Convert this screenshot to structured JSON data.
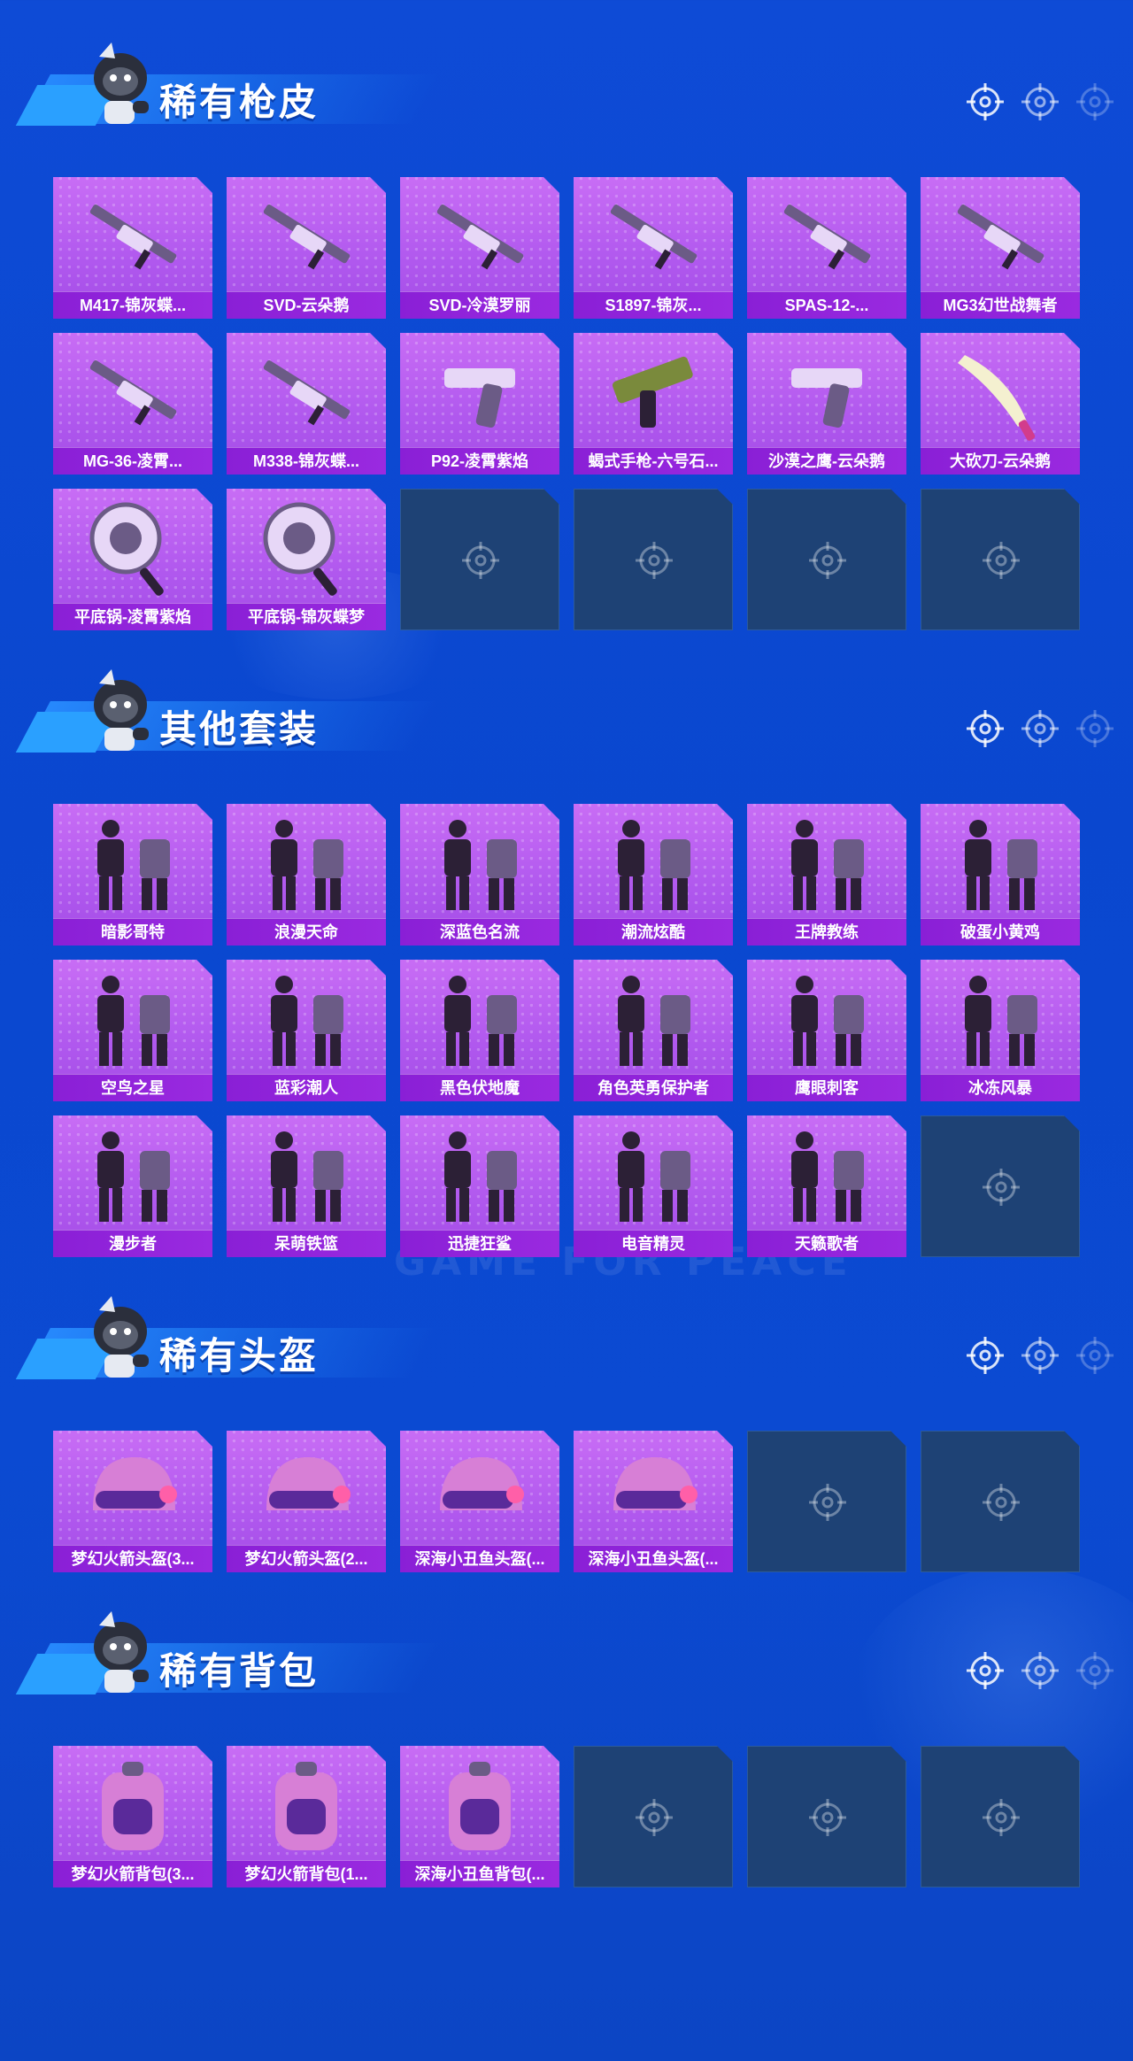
{
  "sections": [
    {
      "title": "稀有枪皮",
      "rows": [
        [
          {
            "label": "M417-锦灰蝶...",
            "icon": "rifle-icon"
          },
          {
            "label": "SVD-云朵鹅",
            "icon": "sniper-rifle-icon"
          },
          {
            "label": "SVD-冷漠罗丽",
            "icon": "sniper-rifle-icon"
          },
          {
            "label": "S1897-锦灰...",
            "icon": "shotgun-icon"
          },
          {
            "label": "SPAS-12-...",
            "icon": "shotgun-icon"
          },
          {
            "label": "MG3幻世战舞者",
            "icon": "machine-gun-icon"
          }
        ],
        [
          {
            "label": "MG-36-凌霄...",
            "icon": "rifle-icon"
          },
          {
            "label": "M338-锦灰蝶...",
            "icon": "rifle-icon"
          },
          {
            "label": "P92-凌霄紫焰",
            "icon": "pistol-icon"
          },
          {
            "label": "蝎式手枪-六号石...",
            "icon": "smg-icon"
          },
          {
            "label": "沙漠之鹰-云朵鹅",
            "icon": "pistol-icon"
          },
          {
            "label": "大砍刀-云朵鹅",
            "icon": "machete-icon"
          }
        ],
        [
          {
            "label": "平底锅-凌霄紫焰",
            "icon": "pan-icon"
          },
          {
            "label": "平底锅-锦灰蝶梦",
            "icon": "pan-icon"
          },
          null,
          null,
          null,
          null
        ]
      ]
    },
    {
      "title": "其他套装",
      "rows": [
        [
          {
            "label": "暗影哥特",
            "icon": "outfit-icon"
          },
          {
            "label": "浪漫天命",
            "icon": "outfit-icon"
          },
          {
            "label": "深蓝色名流",
            "icon": "outfit-icon"
          },
          {
            "label": "潮流炫酷",
            "icon": "outfit-icon"
          },
          {
            "label": "王牌教练",
            "icon": "outfit-icon"
          },
          {
            "label": "破蛋小黄鸡",
            "icon": "outfit-icon"
          }
        ],
        [
          {
            "label": "空鸟之星",
            "icon": "outfit-icon"
          },
          {
            "label": "蓝彩潮人",
            "icon": "outfit-icon"
          },
          {
            "label": "黑色伏地魔",
            "icon": "outfit-icon"
          },
          {
            "label": "角色英勇保护者",
            "icon": "outfit-icon"
          },
          {
            "label": "鹰眼刺客",
            "icon": "outfit-icon"
          },
          {
            "label": "冰冻风暴",
            "icon": "outfit-icon"
          }
        ],
        [
          {
            "label": "漫步者",
            "icon": "outfit-icon"
          },
          {
            "label": "呆萌铁篮",
            "icon": "outfit-icon"
          },
          {
            "label": "迅捷狂鲨",
            "icon": "outfit-icon"
          },
          {
            "label": "电音精灵",
            "icon": "outfit-icon"
          },
          {
            "label": "天籁歌者",
            "icon": "outfit-icon"
          },
          null
        ]
      ]
    },
    {
      "title": "稀有头盔",
      "rows": [
        [
          {
            "label": "梦幻火箭头盔(3...",
            "icon": "helmet-icon"
          },
          {
            "label": "梦幻火箭头盔(2...",
            "icon": "helmet-icon"
          },
          {
            "label": "深海小丑鱼头盔(...",
            "icon": "helmet-icon"
          },
          {
            "label": "深海小丑鱼头盔(...",
            "icon": "helmet-icon"
          },
          null,
          null
        ]
      ]
    },
    {
      "title": "稀有背包",
      "rows": [
        [
          {
            "label": "梦幻火箭背包(3...",
            "icon": "backpack-icon"
          },
          {
            "label": "梦幻火箭背包(1...",
            "icon": "backpack-icon"
          },
          {
            "label": "深海小丑鱼背包(...",
            "icon": "backpack-icon"
          },
          null,
          null,
          null
        ]
      ]
    }
  ],
  "watermark": "GAME FOR PEACE",
  "colors": {
    "background": "#0b4ad2",
    "card_purple": "#b058ee",
    "label_purple": "#8a1fd6",
    "empty_slot": "#1e4275"
  }
}
